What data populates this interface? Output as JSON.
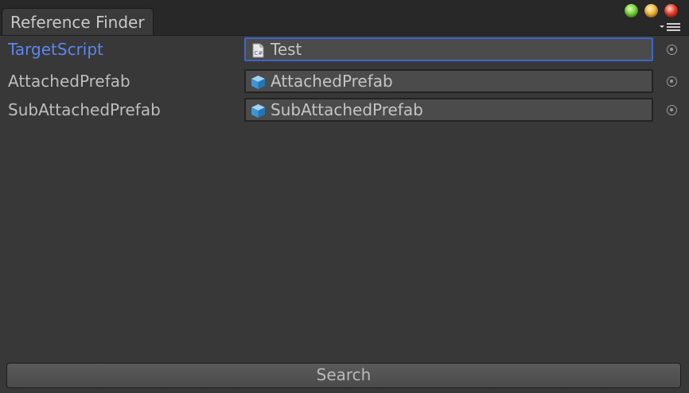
{
  "window": {
    "tab_title": "Reference Finder",
    "controls": [
      "green-button",
      "yellow-button",
      "red-button"
    ],
    "menu_icon": "dropdown-menu-icon"
  },
  "fields": [
    {
      "label": "TargetScript",
      "value": "Test",
      "icon": "csharp-script-icon",
      "active": true
    },
    {
      "label": "AttachedPrefab",
      "value": "AttachedPrefab",
      "icon": "prefab-cube-icon",
      "active": false
    },
    {
      "label": "SubAttachedPrefab",
      "value": "SubAttachedPrefab",
      "icon": "prefab-cube-icon",
      "active": false
    }
  ],
  "search_button": "Search",
  "colors": {
    "background": "#383838",
    "active_label": "#5a87f0",
    "active_border": "#3e64c9"
  }
}
